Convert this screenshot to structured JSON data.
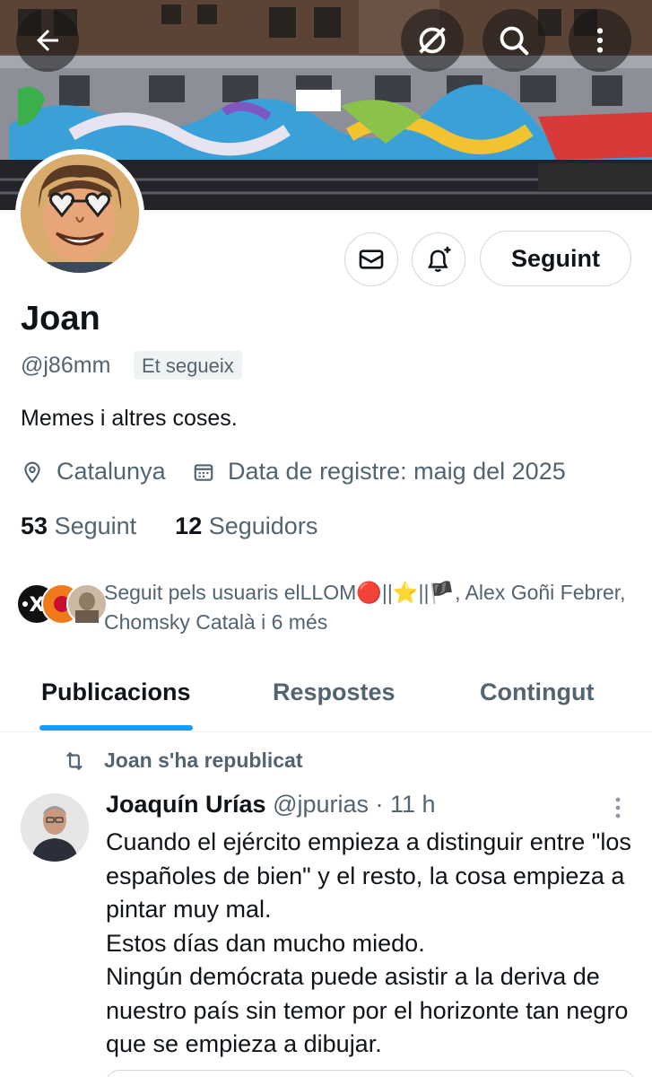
{
  "topbar": {
    "back_icon": "arrow-left-icon",
    "grok_icon": "grok-icon",
    "search_icon": "search-icon",
    "more_icon": "more-vertical-icon"
  },
  "banner": {
    "description_icon": "graffiti-train-banner"
  },
  "profile": {
    "name": "Joan",
    "handle": "@j86mm",
    "follows_you": "Et segueix",
    "bio": "Memes i altres coses.",
    "location": "Catalunya",
    "joined": "Data de registre: maig del 2025",
    "following_count": "53",
    "following_label": "Seguint",
    "followers_count": "12",
    "followers_label": "Seguidors"
  },
  "actions": {
    "message_icon": "envelope-icon",
    "notify_icon": "bell-plus-icon",
    "follow_label": "Seguint"
  },
  "followed_by": {
    "text": "Seguit pels usuaris elLLOM🔴||⭐||🏴, Alex Goñi Febrer, Chomsky Català i 6 més"
  },
  "tabs": [
    {
      "label": "Publicacions",
      "active": true
    },
    {
      "label": "Respostes",
      "active": false
    },
    {
      "label": "Contingut",
      "active": false
    }
  ],
  "tweet": {
    "repost_text": "Joan s'ha republicat",
    "author_name": "Joaquín Urías",
    "author_handle": "@jpurias",
    "time": "· 11 h",
    "lines": [
      "Cuando el ejército empieza a distinguir entre \"los españoles de bien\" y el resto, la cosa empieza a pintar muy mal.",
      "Estos días dan mucho miedo.",
      "Ningún demócrata puede asistir a la deriva de nuestro país sin temor por el horizonte tan negro que se empieza a dibujar."
    ]
  },
  "colors": {
    "accent": "#1d9bf0",
    "text_primary": "#0f1419",
    "text_secondary": "#536471",
    "border": "#cfd9de"
  }
}
